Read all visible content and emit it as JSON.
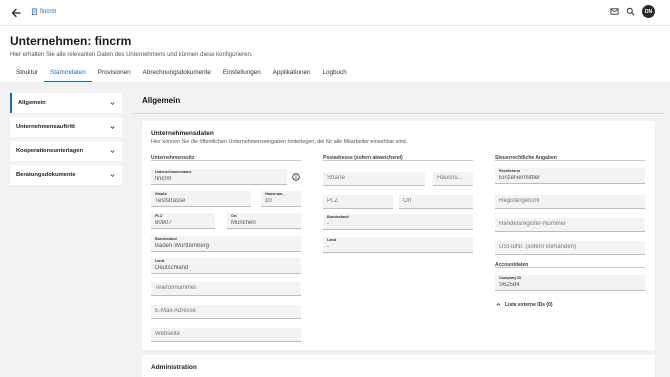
{
  "topbar": {
    "breadcrumb": "fincrm",
    "avatar_initials": "DN",
    "icons": [
      "arrow-back-icon",
      "building-icon",
      "mail-icon",
      "search-icon"
    ]
  },
  "header": {
    "title": "Unternehmen: fincrm",
    "subtitle": "Hier erhalten Sie alle relevanten Daten des Unternehmens und können diese konfigurieren.",
    "tabs": [
      "Struktur",
      "Stammdaten",
      "Provisionen",
      "Abrechnungsdokumente",
      "Einstellungen",
      "Applikationen",
      "Logbuch"
    ],
    "active_tab": "Stammdaten"
  },
  "sidebar": {
    "items": [
      "Allgemein",
      "Unternehmensauftritt",
      "Kooperationsunterlagen",
      "Beratungsdokumente"
    ],
    "active": "Allgemein"
  },
  "main": {
    "title": "Allgemein",
    "card": {
      "title": "Unternehmensdaten",
      "subtitle": "Hier können Sie die öffentlichen Unternehmenseingaben hinterlegen, die für alle Mitarbeiter einsehbar sind.",
      "col1": {
        "heading": "Unternehmenssitz",
        "company_name": {
          "label": "Unternehmensname",
          "value": "fincrm"
        },
        "street": {
          "label": "Straße",
          "value": "Teststrasse"
        },
        "house_no": {
          "label": "Hausnum...",
          "value": "10"
        },
        "zip": {
          "label": "PLZ",
          "value": "80807"
        },
        "city": {
          "label": "Ort",
          "value": "München"
        },
        "state": {
          "label": "Bundesland",
          "value": "Baden-Württemberg"
        },
        "country": {
          "label": "Land",
          "value": "Deutschland"
        },
        "phone": {
          "placeholder": "Telefonnummer"
        },
        "email": {
          "placeholder": "E-Mail-Adresse"
        },
        "website": {
          "placeholder": "Webseite"
        }
      },
      "col2": {
        "heading": "Postadresse (sofern abweichend)",
        "street": {
          "placeholder": "Straße"
        },
        "house_no": {
          "placeholder": "Hausnu..."
        },
        "zip": {
          "placeholder": "PLZ"
        },
        "city": {
          "placeholder": "Ort"
        },
        "state": {
          "label": "Bundesland",
          "value": "-"
        },
        "country": {
          "label": "Land",
          "value": "-"
        }
      },
      "col3": {
        "heading": "Steuerrechtliche Angaben",
        "legal_form": {
          "label": "Rechtsform",
          "value": "Einzelvermittler"
        },
        "register_court": {
          "placeholder": "Registergericht"
        },
        "trade_register": {
          "placeholder": "Handelsregister-Nummer"
        },
        "vat_id": {
          "placeholder": "USt-IdNr. (sofern vorhanden)"
        },
        "accounts_heading": "Accountdaten",
        "company_id": {
          "label": "Company ID",
          "value": "S62584"
        },
        "external_ids": "Liste externe IDs (0)"
      }
    },
    "admin_title": "Administration"
  },
  "colors": {
    "accent": "#1f6aa8",
    "background": "#f2f2f2",
    "field": "#f3f3f3"
  }
}
